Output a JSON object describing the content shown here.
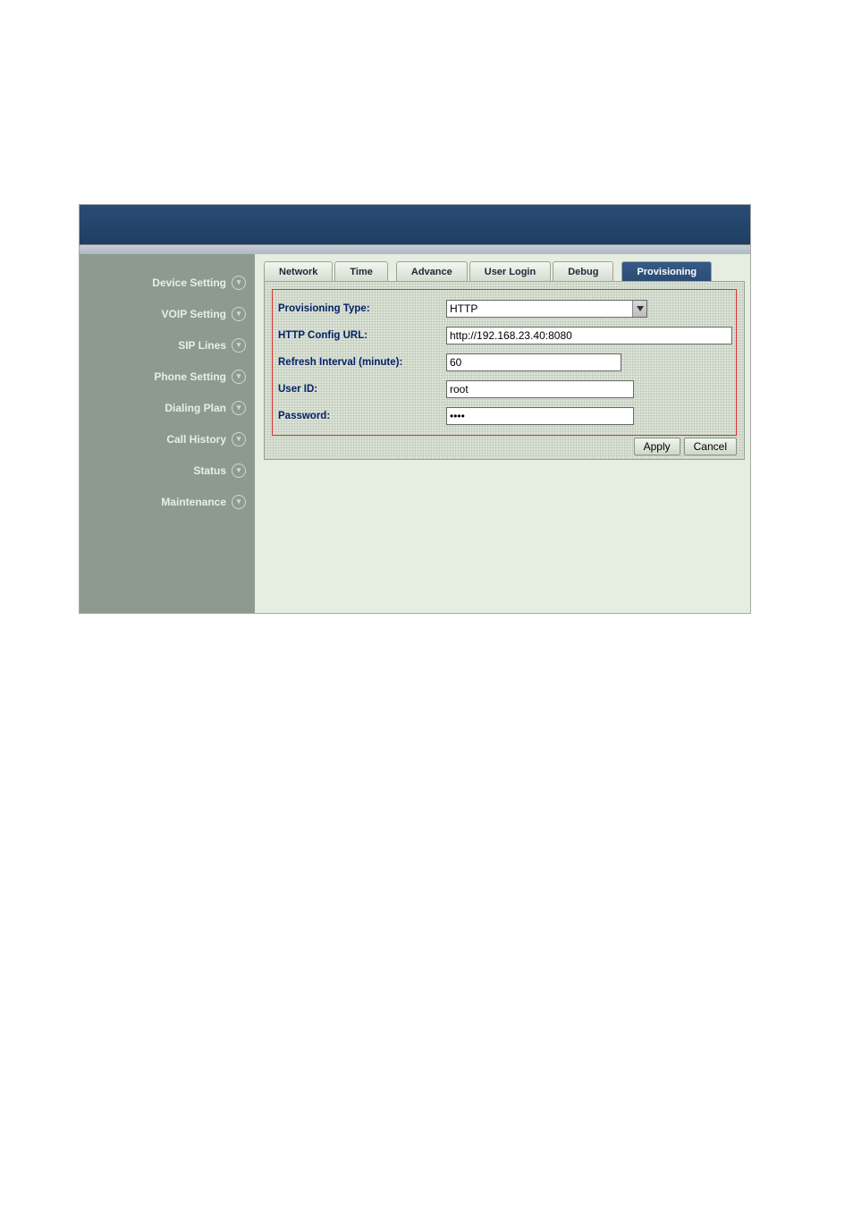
{
  "sidebar": {
    "items": [
      {
        "label": "Device Setting"
      },
      {
        "label": "VOIP Setting"
      },
      {
        "label": "SIP Lines"
      },
      {
        "label": "Phone Setting"
      },
      {
        "label": "Dialing Plan"
      },
      {
        "label": "Call History"
      },
      {
        "label": "Status"
      },
      {
        "label": "Maintenance"
      }
    ]
  },
  "tabs": {
    "items": [
      {
        "label": "Network"
      },
      {
        "label": "Time"
      },
      {
        "label": "Advance"
      },
      {
        "label": "User Login"
      },
      {
        "label": "Debug"
      },
      {
        "label": "Provisioning"
      }
    ],
    "active": 5
  },
  "form": {
    "provisioning_type": {
      "label": "Provisioning Type:",
      "value": "HTTP"
    },
    "http_url": {
      "label": "HTTP Config URL:",
      "value": "http://192.168.23.40:8080"
    },
    "refresh": {
      "label": "Refresh Interval (minute):",
      "value": "60"
    },
    "user_id": {
      "label": "User ID:",
      "value": "root"
    },
    "password": {
      "label": "Password:",
      "value": "••••"
    }
  },
  "buttons": {
    "apply": "Apply",
    "cancel": "Cancel"
  }
}
